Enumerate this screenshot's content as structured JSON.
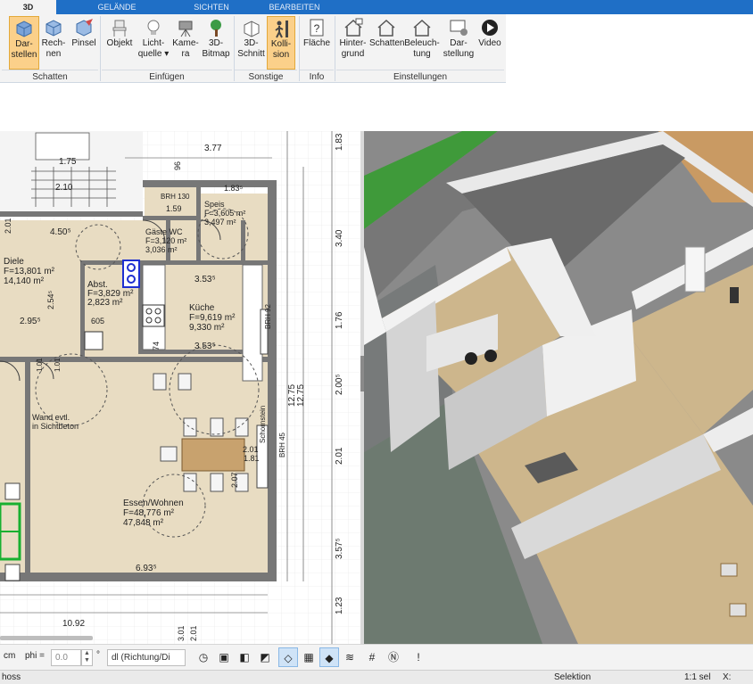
{
  "tabs": [
    {
      "label": "3D"
    },
    {
      "label": "GELÄNDE"
    },
    {
      "label": "SICHTEN"
    },
    {
      "label": "BEARBEITEN"
    }
  ],
  "ribbon": {
    "buttons": [
      {
        "label1": "Dar-",
        "label2": "stellen",
        "icon": "display-cube-icon"
      },
      {
        "label1": "Rech-",
        "label2": "nen",
        "icon": "compute-cube-icon"
      },
      {
        "label1": "Pinsel",
        "label2": "",
        "icon": "brush-icon"
      },
      {
        "label1": "Objekt",
        "label2": "",
        "icon": "chair-icon"
      },
      {
        "label1": "Licht-",
        "label2": "quelle ▾",
        "icon": "lightbulb-icon"
      },
      {
        "label1": "Kame-",
        "label2": "ra",
        "icon": "camera-icon"
      },
      {
        "label1": "3D-",
        "label2": "Bitmap",
        "icon": "tree-icon"
      },
      {
        "label1": "3D-",
        "label2": "Schnitt",
        "icon": "section-cut-icon"
      },
      {
        "label1": "Kolli-",
        "label2": "sion",
        "icon": "collision-person-icon"
      },
      {
        "label1": "Fläche",
        "label2": "",
        "icon": "area-info-icon"
      },
      {
        "label1": "Hinter-",
        "label2": "grund",
        "icon": "house-background-icon"
      },
      {
        "label1": "Schatten",
        "label2": "",
        "icon": "house-shadow-icon"
      },
      {
        "label1": "Beleuch-",
        "label2": "tung",
        "icon": "house-lighting-icon"
      },
      {
        "label1": "Dar-",
        "label2": "stellung",
        "icon": "monitor-settings-icon"
      },
      {
        "label1": "Video",
        "label2": "",
        "icon": "play-icon"
      }
    ],
    "groups": [
      {
        "label": "Schatten"
      },
      {
        "label": "Einfügen"
      },
      {
        "label": "Sonstige"
      },
      {
        "label": "Info"
      },
      {
        "label": "Einstellungen"
      }
    ]
  },
  "plan": {
    "rooms": [
      {
        "name": "Diele",
        "area1": "F=13,801 m²",
        "area2": "14,140 m²"
      },
      {
        "name": "Abst.",
        "area1": "F=3,829 m²",
        "area2": "2,823 m²"
      },
      {
        "name": "Küche",
        "area1": "F=9,619 m²",
        "area2": "9,330 m²"
      },
      {
        "name": "Speis",
        "area1": "F=3,605 m²",
        "area2": "3,497 m²"
      },
      {
        "name": "Gäste WC",
        "area1": "F=3,120 m²",
        "area2": "3,036 m²"
      },
      {
        "name": "Essen/Wohnen",
        "area1": "F=48,776 m²",
        "area2": "47,848 m²"
      }
    ],
    "notes": [
      {
        "text": "Wand evtl."
      },
      {
        "text": "in Sichtbeton"
      },
      {
        "text": "Schornstein"
      },
      {
        "text": "BRH 45"
      },
      {
        "text": "BRH 130"
      },
      {
        "text": "BRH 92"
      }
    ],
    "dimensions": [
      {
        "text": "3.77"
      },
      {
        "text": "4.50⁵"
      },
      {
        "text": "2.10"
      },
      {
        "text": "1.75"
      },
      {
        "text": "2.95⁵"
      },
      {
        "text": "3.53⁵"
      },
      {
        "text": "3.53⁵"
      },
      {
        "text": "6.93⁵"
      },
      {
        "text": "10.92"
      },
      {
        "text": "2.54⁵"
      },
      {
        "text": "1.83⁵"
      },
      {
        "text": "2.01"
      },
      {
        "text": "1.81"
      },
      {
        "text": "2.07"
      },
      {
        "text": "2.01"
      },
      {
        "text": "12.75"
      },
      {
        "text": "12.75"
      },
      {
        "text": "1.83"
      },
      {
        "text": "3.40"
      },
      {
        "text": "1.76"
      },
      {
        "text": "2.00⁵"
      },
      {
        "text": "2.01"
      },
      {
        "text": "3.57⁵"
      },
      {
        "text": "1.23"
      },
      {
        "text": "1.01"
      },
      {
        "text": "1.01"
      },
      {
        "text": "1.59"
      },
      {
        "text": "3.01"
      },
      {
        "text": "2.01"
      },
      {
        "text": "96"
      },
      {
        "text": "605"
      },
      {
        "text": "74"
      }
    ]
  },
  "toolbar": {
    "unit": "cm",
    "phi_label": "phi =",
    "phi_value": "0.0",
    "degree": "°",
    "direction_select": "dl (Richtung/Di"
  },
  "status": {
    "left": "hoss",
    "mode": "Selektion",
    "scale": "1:1 sel",
    "x_label": "X:"
  }
}
